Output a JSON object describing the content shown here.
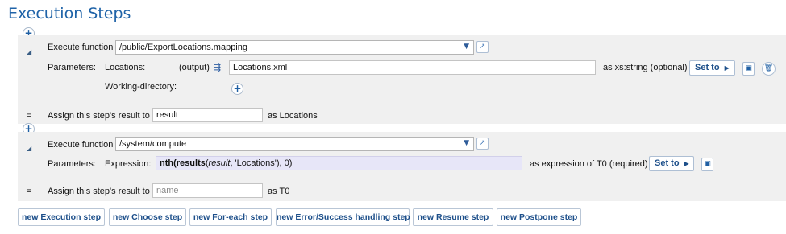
{
  "page": {
    "title": "Execution Steps"
  },
  "step1": {
    "execute_label": "Execute function",
    "function": "/public/ExportLocations.mapping",
    "parameters_label": "Parameters:",
    "params": [
      {
        "name": "Locations:",
        "mode": "(output)",
        "value": "Locations.xml",
        "type": "as xs:string (optional)",
        "set_to": "Set to"
      },
      {
        "name": "Working-directory:"
      }
    ],
    "assign_label": "Assign this step's result to",
    "assign_value": "result",
    "assign_as": "as Locations"
  },
  "step2": {
    "execute_label": "Execute function",
    "function": "/system/compute",
    "parameters_label": "Parameters:",
    "expression_label": "Expression:",
    "expression": {
      "fn": "nth",
      "p1": "(",
      "inner_fn": "results",
      "p2": "(",
      "var": "result",
      "str": ", 'Locations'",
      "tail": "), 0)"
    },
    "type": "as expression of T0 (required)",
    "set_to": "Set to",
    "assign_label": "Assign this step's result to",
    "assign_placeholder": "name",
    "assign_as": "as T0"
  },
  "glyphs": {
    "eq": "=",
    "collapse": "◢",
    "plus": "+",
    "dropdown": "▼",
    "open": "↗",
    "tri": "▶",
    "save": "▣",
    "trash": "🗑",
    "output": "⇶"
  },
  "buttons": [
    "new Execution step",
    "new Choose step",
    "new For-each step",
    "new Error/Success handling step",
    "new Resume step",
    "new Postpone step"
  ]
}
